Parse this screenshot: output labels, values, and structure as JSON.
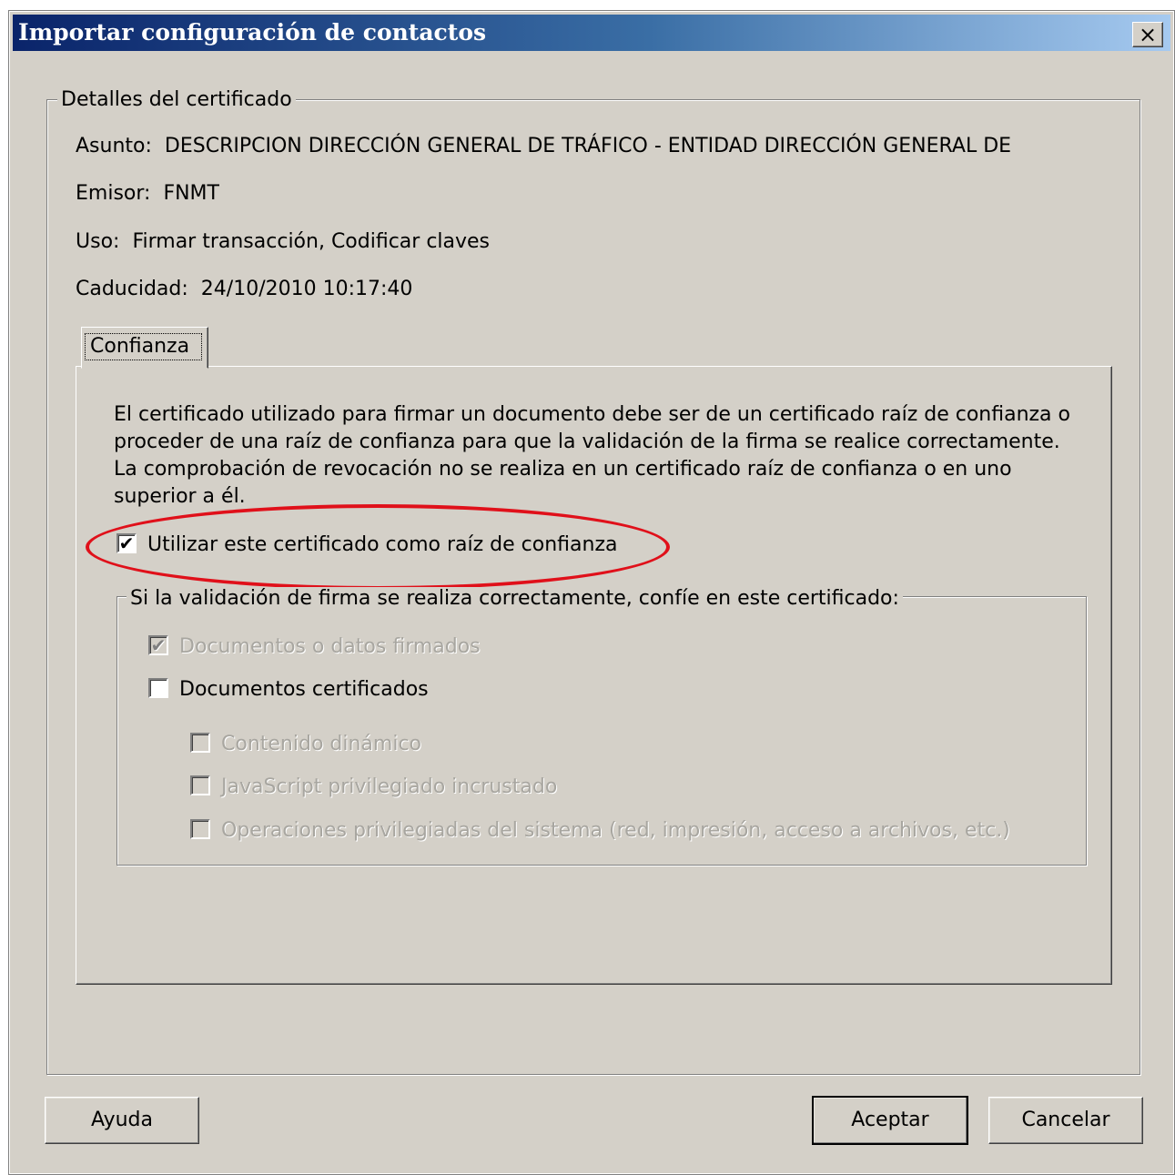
{
  "window": {
    "title": "Importar configuración de contactos",
    "close_label": "✕"
  },
  "details": {
    "legend": "Detalles del certificado",
    "subject_label": "Asunto:",
    "subject_value": "DESCRIPCION DIRECCIÓN GENERAL DE TRÁFICO - ENTIDAD DIRECCIÓN GENERAL DE",
    "issuer_label": "Emisor:",
    "issuer_value": "FNMT",
    "usage_label": "Uso:",
    "usage_value": "Firmar transacción, Codificar claves",
    "expiry_label": "Caducidad:",
    "expiry_value": "24/10/2010 10:17:40"
  },
  "tabs": [
    {
      "label": "Confianza",
      "active": true
    }
  ],
  "trust": {
    "description": "El certificado utilizado para firmar un documento debe ser de un certificado raíz de confianza o proceder de una raíz de confianza para que la validación de la firma se realice correctamente. La comprobación de revocación no se realiza en un certificado raíz de confianza o en uno superior a él.",
    "use_as_root": {
      "label": "Utilizar este certificado como raíz de confianza",
      "checked": true
    },
    "group_legend": "Si la validación de firma se realiza correctamente, confíe en este certificado:",
    "options": {
      "signed_docs": {
        "label": "Documentos o datos firmados",
        "checked": true,
        "enabled": false
      },
      "certified_docs": {
        "label": "Documentos certificados",
        "checked": false,
        "enabled": true
      },
      "dynamic_content": {
        "label": "Contenido dinámico",
        "checked": false,
        "enabled": false
      },
      "javascript": {
        "label": "JavaScript privilegiado incrustado",
        "checked": false,
        "enabled": false
      },
      "system_ops": {
        "label": "Operaciones privilegiadas del sistema (red, impresión, acceso a archivos, etc.)",
        "checked": false,
        "enabled": false
      }
    },
    "check_mark": "✔"
  },
  "buttons": {
    "help": "Ayuda",
    "ok": "Aceptar",
    "cancel": "Cancelar"
  },
  "colors": {
    "dialog_bg": "#d4d0c8",
    "title_start": "#0a246a",
    "title_end": "#a6caf0",
    "highlight_ellipse": "#e0101a"
  }
}
